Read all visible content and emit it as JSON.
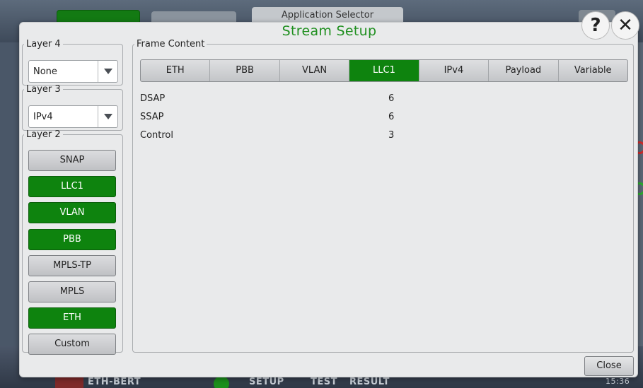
{
  "background": {
    "app_selector_label": "Application Selector",
    "status_bar": {
      "app_name": "ETH-BERT",
      "tabs": [
        "SETUP",
        "TEST",
        "RESULT"
      ],
      "time": "15:36"
    }
  },
  "dialog": {
    "title": "Stream Setup",
    "help_icon": "?",
    "close_icon": "✕",
    "close_label": "Close"
  },
  "layer4": {
    "legend": "Layer 4",
    "value": "None"
  },
  "layer3": {
    "legend": "Layer 3",
    "value": "IPv4"
  },
  "layer2": {
    "legend": "Layer 2",
    "buttons": [
      {
        "label": "SNAP",
        "active": false
      },
      {
        "label": "LLC1",
        "active": true
      },
      {
        "label": "VLAN",
        "active": true
      },
      {
        "label": "PBB",
        "active": true
      },
      {
        "label": "MPLS-TP",
        "active": false
      },
      {
        "label": "MPLS",
        "active": false
      },
      {
        "label": "ETH",
        "active": true
      },
      {
        "label": "Custom",
        "active": false
      }
    ]
  },
  "frame_content": {
    "legend": "Frame Content",
    "tabs": [
      {
        "label": "ETH",
        "active": false
      },
      {
        "label": "PBB",
        "active": false
      },
      {
        "label": "VLAN",
        "active": false
      },
      {
        "label": "LLC1",
        "active": true
      },
      {
        "label": "IPv4",
        "active": false
      },
      {
        "label": "Payload",
        "active": false
      },
      {
        "label": "Variable",
        "active": false
      }
    ],
    "fields": [
      {
        "name": "DSAP",
        "value": "6"
      },
      {
        "name": "SSAP",
        "value": "6"
      },
      {
        "name": "Control",
        "value": "3"
      }
    ]
  },
  "colors": {
    "accent_green": "#0e830e",
    "title_green": "#1f8f1f"
  }
}
